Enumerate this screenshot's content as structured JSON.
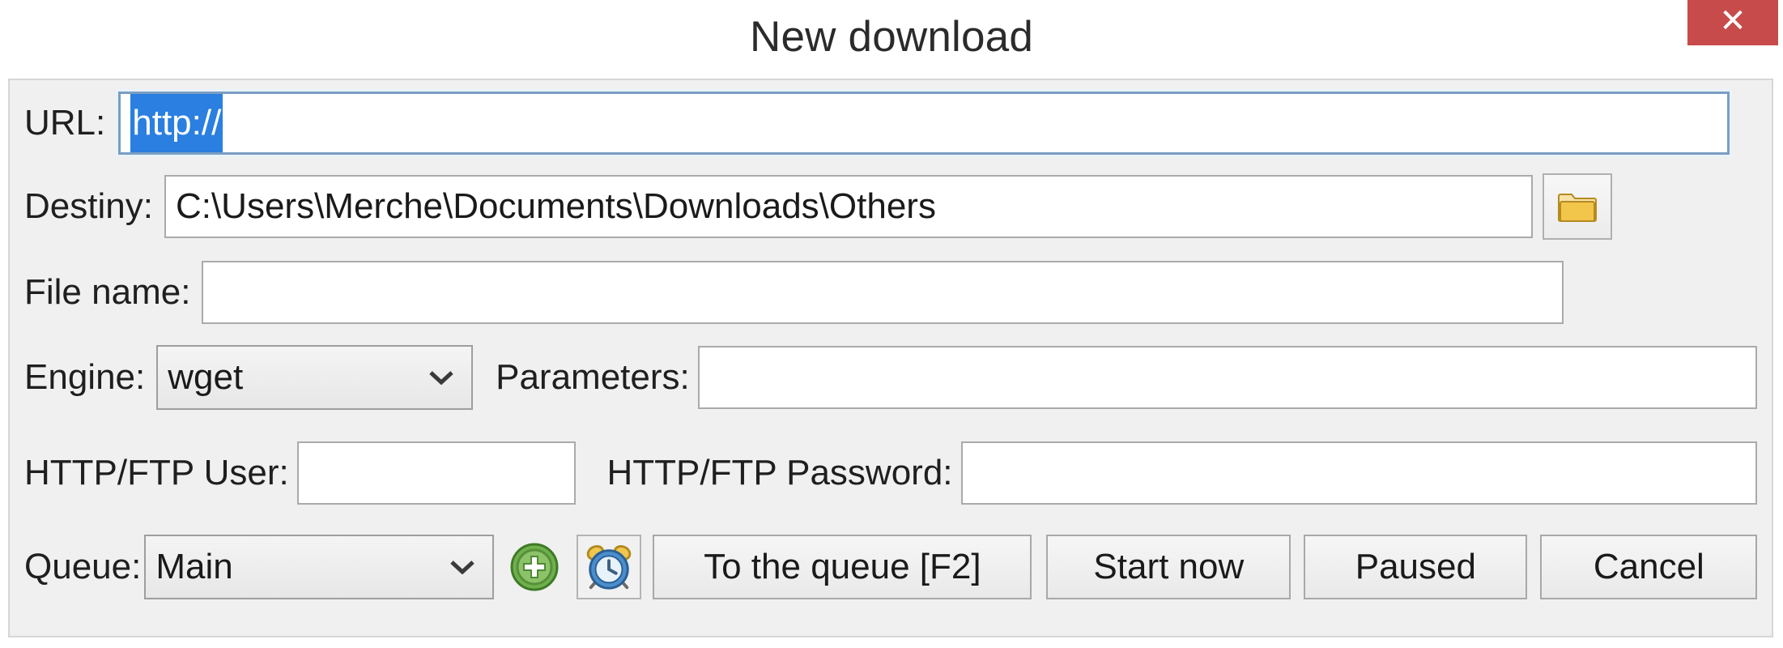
{
  "window": {
    "title": "New download",
    "close_label": "✕"
  },
  "colors": {
    "close_button_bg": "#c74b4b",
    "selection_bg": "#2a7fe0",
    "panel_bg": "#f0f0f0",
    "focus_border": "#7a9ec2",
    "add_icon_green": "#5fa843",
    "clock_icon_blue": "#3f7cc2",
    "folder_icon_yellow": "#e7b63a"
  },
  "form": {
    "url": {
      "label": "URL:",
      "value": "http://",
      "selected": true,
      "placeholder": ""
    },
    "destiny": {
      "label": "Destiny:",
      "value": "C:\\Users\\Merche\\Documents\\Downloads\\Others",
      "placeholder": "",
      "browse_icon": "folder-icon"
    },
    "file_name": {
      "label": "File name:",
      "value": "",
      "placeholder": ""
    },
    "engine": {
      "label": "Engine:",
      "value": "wget",
      "options": [
        "wget"
      ],
      "chevron_icon": "chevron-down-icon"
    },
    "parameters": {
      "label": "Parameters:",
      "value": "",
      "placeholder": ""
    },
    "http_user": {
      "label": "HTTP/FTP User:",
      "value": "",
      "placeholder": ""
    },
    "http_password": {
      "label": "HTTP/FTP Password:",
      "value": "",
      "placeholder": ""
    },
    "queue": {
      "label": "Queue:",
      "value": "Main",
      "options": [
        "Main"
      ],
      "chevron_icon": "chevron-down-icon"
    }
  },
  "actions": {
    "add_queue_icon": "add-circle-icon",
    "schedule_icon": "alarm-clock-icon",
    "to_the_queue": "To the queue [F2]",
    "start_now": "Start now",
    "paused": "Paused",
    "cancel": "Cancel"
  }
}
